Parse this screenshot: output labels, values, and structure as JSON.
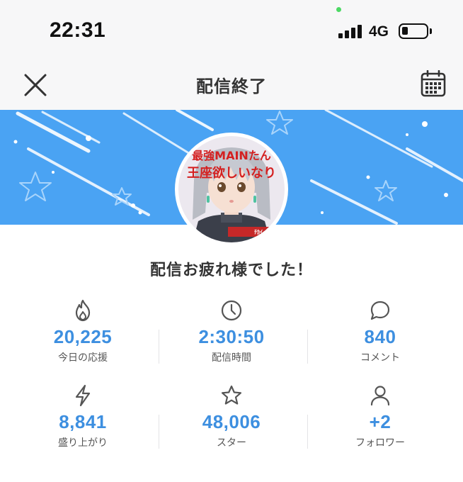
{
  "status_bar": {
    "time": "22:31",
    "network": "4G",
    "icons": [
      "signal-icon",
      "battery-icon"
    ],
    "battery_level": 0.25
  },
  "nav": {
    "title": "配信終了",
    "left_icon": "close-icon",
    "right_icon": "calendar-icon"
  },
  "avatar": {
    "caption_lines": [
      "最強MAINたん",
      "王座欲しいなり",
      "ﾁｶｲ"
    ]
  },
  "message": "配信お疲れ様でした！",
  "colors": {
    "banner": "#4aa3f3",
    "accent": "#3d8fe0",
    "nav_background": "#f7f7f8"
  },
  "stats": [
    {
      "icon": "flame-icon",
      "value": "20,225",
      "label": "今日の応援"
    },
    {
      "icon": "clock-icon",
      "value": "2:30:50",
      "label": "配信時間"
    },
    {
      "icon": "comment-icon",
      "value": "840",
      "label": "コメント"
    },
    {
      "icon": "lightning-icon",
      "value": "8,841",
      "label": "盛り上がり"
    },
    {
      "icon": "star-icon",
      "value": "48,006",
      "label": "スター"
    },
    {
      "icon": "user-icon",
      "value": "+2",
      "label": "フォロワー"
    }
  ]
}
